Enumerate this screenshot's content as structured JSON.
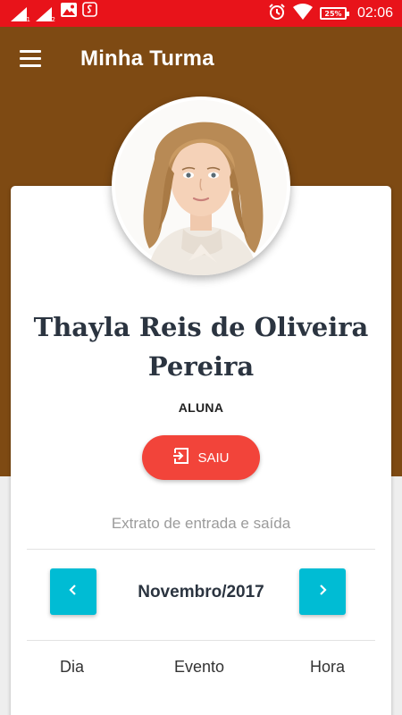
{
  "status_bar": {
    "sim1_label": "1",
    "sim2_label": "2",
    "battery_percent": "25%",
    "time": "02:06",
    "icons": [
      "signal-icon",
      "signal-icon",
      "image-icon",
      "app-notification-icon",
      "alarm-icon",
      "wifi-icon",
      "battery-icon"
    ]
  },
  "app_bar": {
    "title": "Minha Turma",
    "menu_icon": "menu-icon"
  },
  "profile": {
    "name": "Thayla Reis de Oliveira Pereira",
    "role": "ALUNA",
    "status_button": {
      "label": "SAIU",
      "icon": "exit-icon"
    }
  },
  "statement": {
    "title": "Extrato de entrada e saída",
    "month": "Novembro/2017",
    "prev_icon": "chevron-left-icon",
    "next_icon": "chevron-right-icon",
    "columns": [
      "Dia",
      "Evento",
      "Hora"
    ]
  },
  "colors": {
    "status_bar": "#e8131a",
    "header_brown": "#7e4a13",
    "primary_button": "#f2443a",
    "nav_button": "#00bcd4",
    "name_text": "#2b3440"
  }
}
